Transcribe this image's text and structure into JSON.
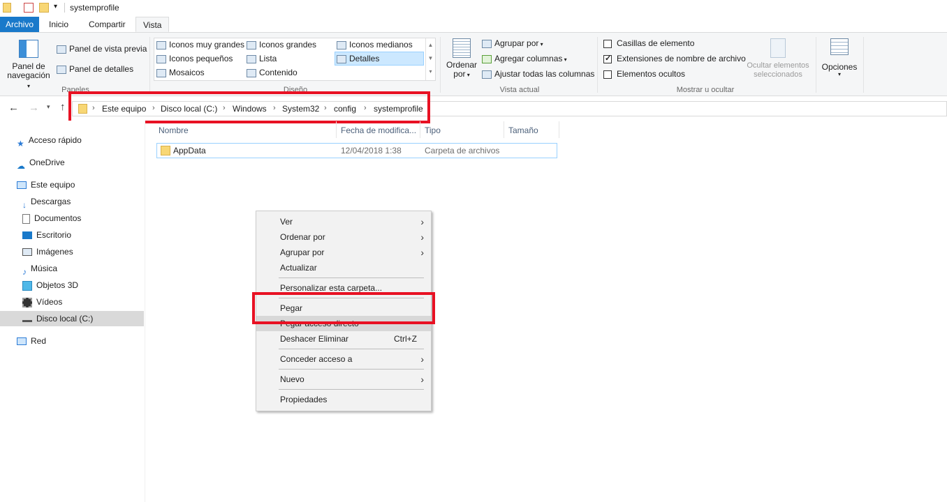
{
  "window": {
    "title": "systemprofile"
  },
  "tabs": [
    "Archivo",
    "Inicio",
    "Compartir",
    "Vista"
  ],
  "ribbon": {
    "panels": {
      "nav_pane": "Panel de navegación",
      "nav_pane_l1": "Panel de",
      "nav_pane_l2": "navegación",
      "preview": "Panel de vista previa",
      "details": "Panel de detalles",
      "label": "Paneles"
    },
    "layout": {
      "items": [
        "Iconos muy grandes",
        "Iconos grandes",
        "Iconos medianos",
        "Iconos pequeños",
        "Lista",
        "Detalles",
        "Mosaicos",
        "Contenido"
      ],
      "label": "Diseño",
      "selected": "Detalles"
    },
    "current_view": {
      "sort_l1": "Ordenar",
      "sort_l2": "por",
      "group_by": "Agrupar por",
      "add_columns": "Agregar columnas",
      "fit_columns": "Ajustar todas las columnas",
      "label": "Vista actual"
    },
    "show_hide": {
      "checkboxes": [
        {
          "label": "Casillas de elemento",
          "checked": false
        },
        {
          "label": "Extensiones de nombre de archivo",
          "checked": true
        },
        {
          "label": "Elementos ocultos",
          "checked": false
        }
      ],
      "hide_selected_l1": "Ocultar elementos",
      "hide_selected_l2": "seleccionados",
      "label": "Mostrar u ocultar"
    },
    "options": "Opciones"
  },
  "address": {
    "crumbs": [
      "Este equipo",
      "Disco local (C:)",
      "Windows",
      "System32",
      "config",
      "systemprofile"
    ]
  },
  "sidebar": {
    "items": [
      "Acceso rápido",
      "OneDrive",
      "Este equipo",
      "Descargas",
      "Documentos",
      "Escritorio",
      "Imágenes",
      "Música",
      "Objetos 3D",
      "Vídeos",
      "Disco local (C:)",
      "Red"
    ]
  },
  "columns": [
    "Nombre",
    "Fecha de modifica...",
    "Tipo",
    "Tamaño"
  ],
  "files": [
    {
      "name": "AppData",
      "date": "12/04/2018 1:38",
      "type": "Carpeta de archivos",
      "size": ""
    }
  ],
  "context_menu": {
    "items": [
      {
        "label": "Ver",
        "submenu": true
      },
      {
        "label": "Ordenar por",
        "submenu": true
      },
      {
        "label": "Agrupar por",
        "submenu": true
      },
      {
        "label": "Actualizar"
      },
      {
        "label": "Personalizar esta carpeta..."
      },
      {
        "label": "Pegar"
      },
      {
        "label": "Pegar acceso directo"
      },
      {
        "label": "Deshacer Eliminar",
        "shortcut": "Ctrl+Z"
      },
      {
        "label": "Conceder acceso a",
        "submenu": true
      },
      {
        "label": "Nuevo",
        "submenu": true
      },
      {
        "label": "Propiedades"
      }
    ]
  },
  "colors": {
    "accent": "#1979ca",
    "highlight_box": "#e81123",
    "selection": "#cce8ff"
  }
}
